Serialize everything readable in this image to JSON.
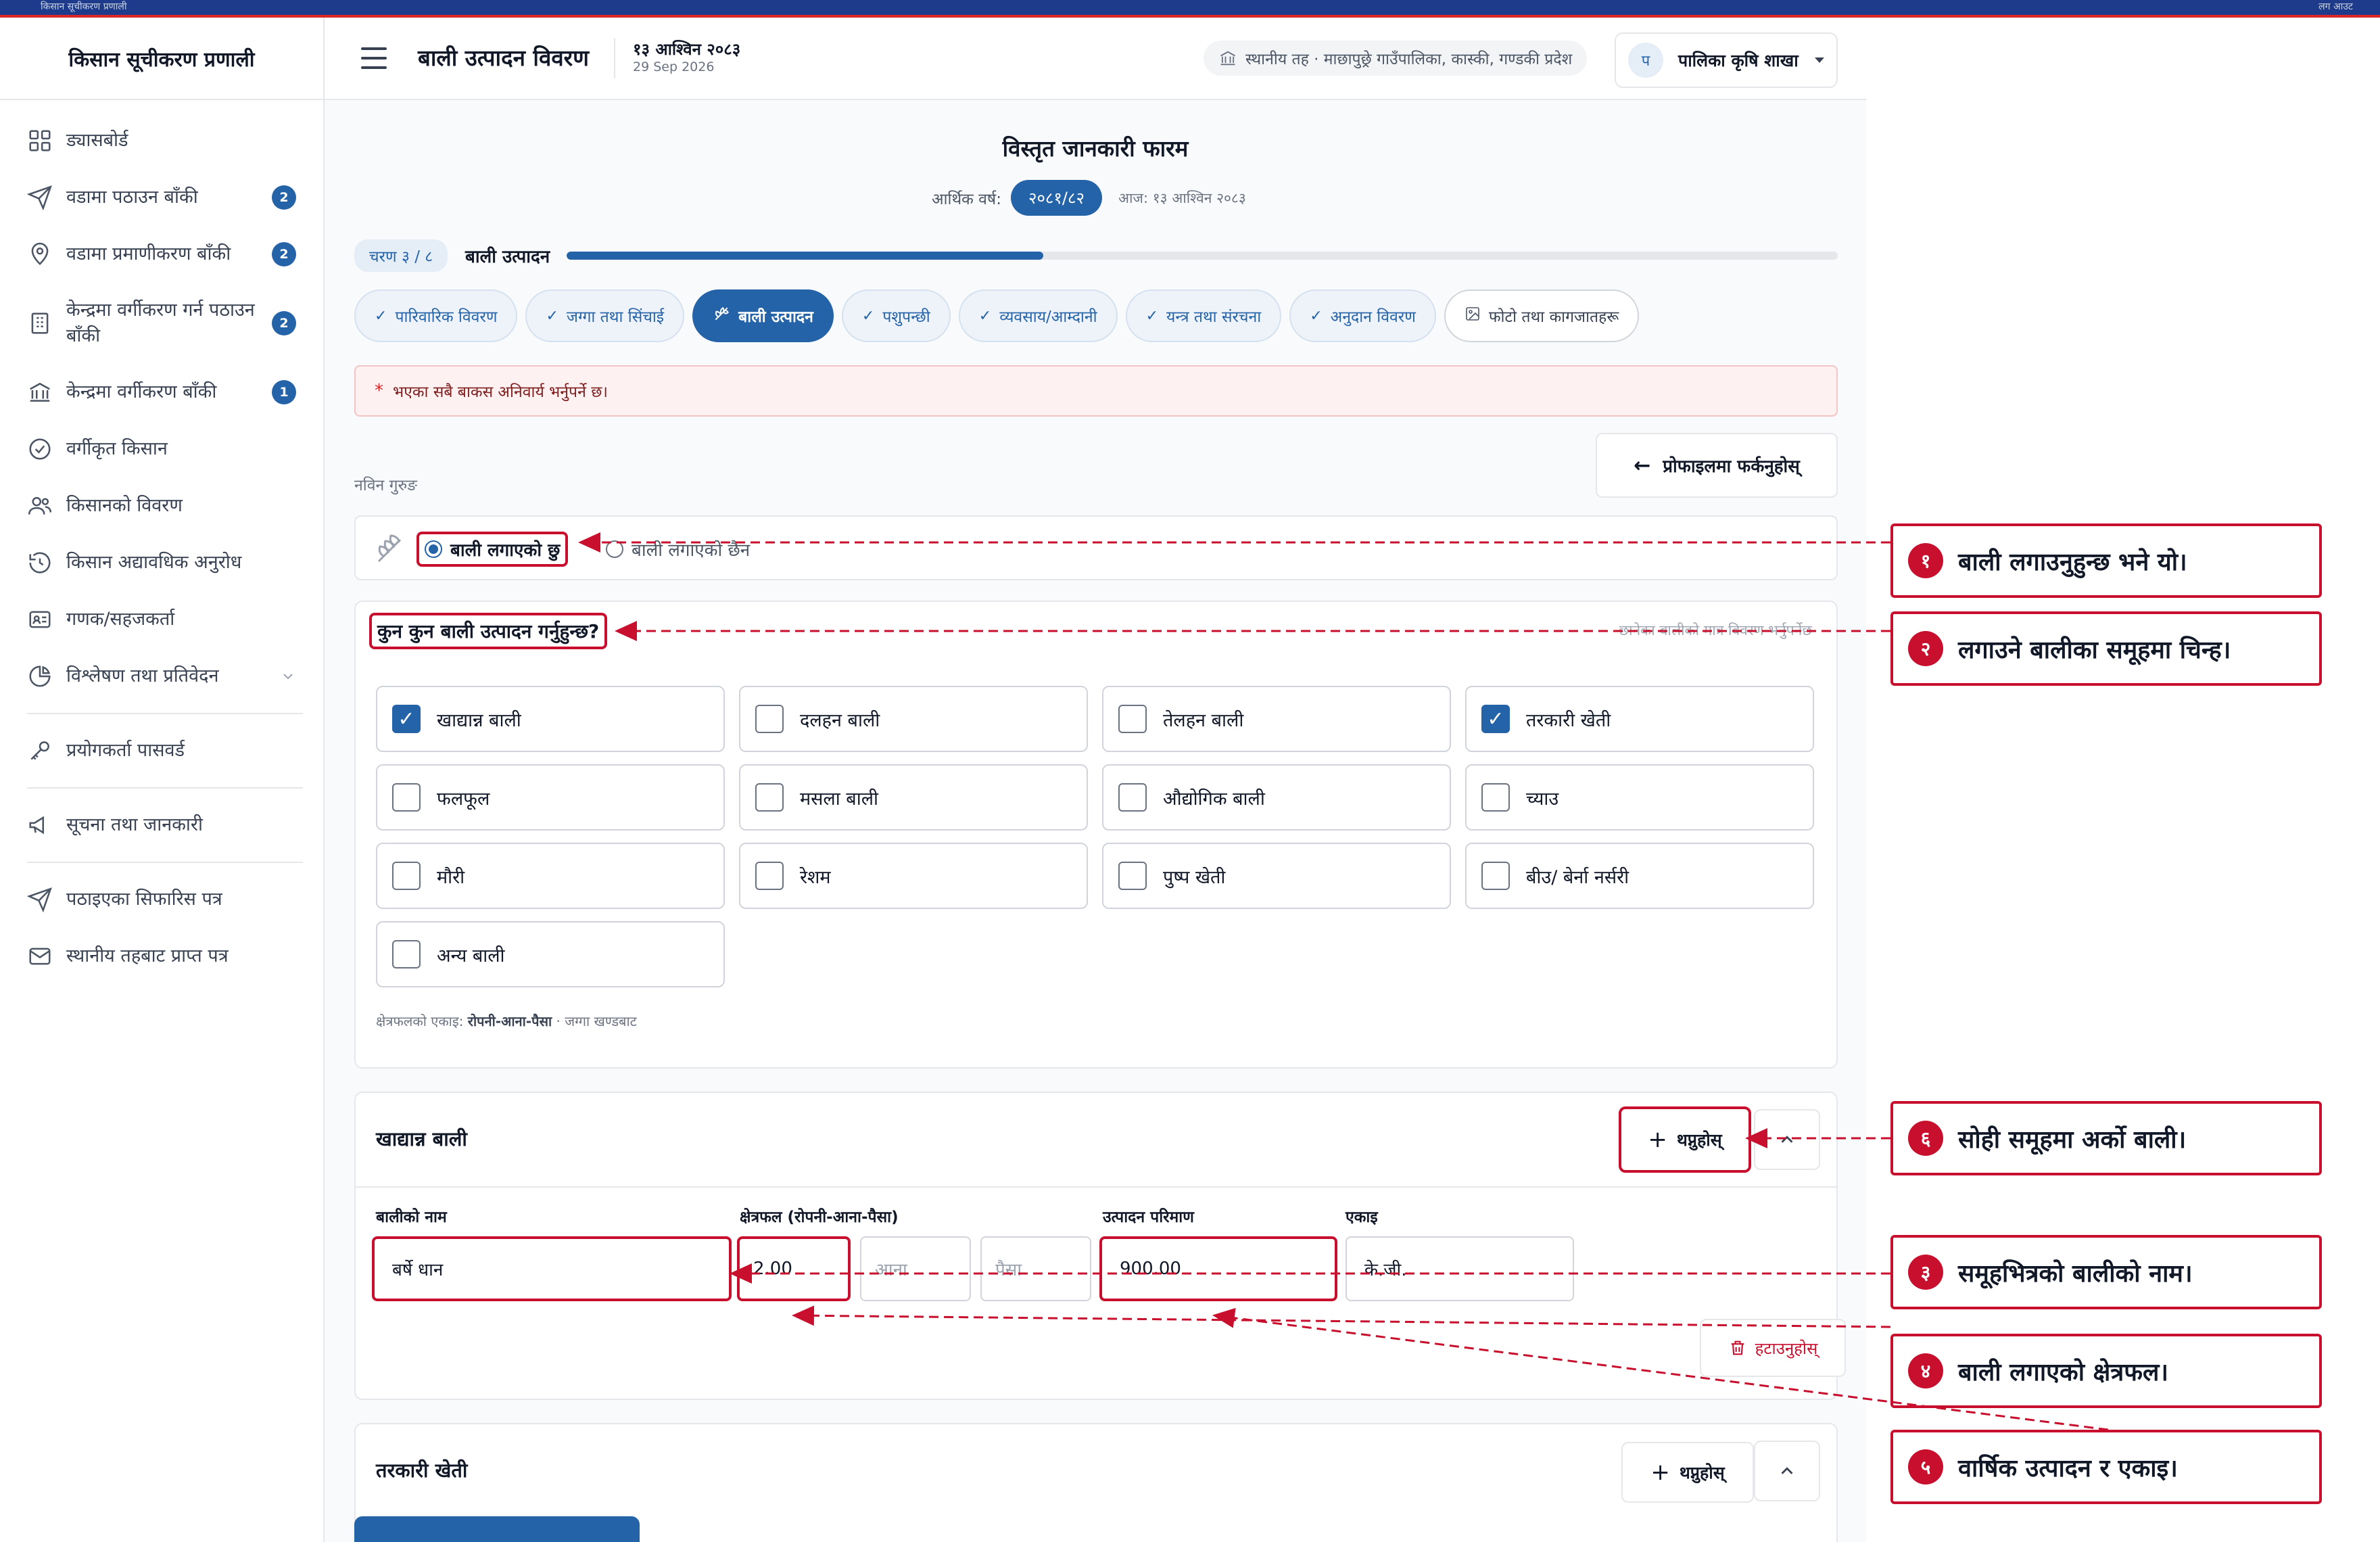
{
  "app": {
    "title": "किसान सूचीकरण प्रणाली",
    "topbar_left": "किसान सूचीकरण प्रणाली",
    "topbar_right": "लग आउट",
    "accent_color": "#2563a8",
    "annotation_color": "#c8102e"
  },
  "sidebar": {
    "items": [
      {
        "label": "ड्यासबोर्ड",
        "icon": "dashboard-icon",
        "badge": ""
      },
      {
        "label": "वडामा पठाउन बाँकी",
        "icon": "send-icon",
        "badge": "2"
      },
      {
        "label": "वडामा प्रमाणीकरण बाँकी",
        "icon": "location-pin-icon",
        "badge": "2"
      },
      {
        "label": "केन्द्रमा वर्गीकरण गर्न पठाउन बाँकी",
        "icon": "building-icon",
        "badge": "2"
      },
      {
        "label": "केन्द्रमा वर्गीकरण बाँकी",
        "icon": "bank-icon",
        "badge": "1"
      },
      {
        "label": "वर्गीकृत किसान",
        "icon": "check-circle-icon",
        "badge": ""
      },
      {
        "label": "किसानको विवरण",
        "icon": "users-icon",
        "badge": ""
      },
      {
        "label": "किसान अद्यावधिक अनुरोध",
        "icon": "history-icon",
        "badge": ""
      },
      {
        "label": "गणक/सहजकर्ता",
        "icon": "id-card-icon",
        "badge": ""
      },
      {
        "label": "विश्लेषण तथा प्रतिवेदन",
        "icon": "pie-chart-icon",
        "badge": ""
      },
      {
        "label": "प्रयोगकर्ता पासवर्ड",
        "icon": "key-icon",
        "badge": ""
      },
      {
        "label": "सूचना तथा जानकारी",
        "icon": "megaphone-icon",
        "badge": ""
      },
      {
        "label": "पठाइएका सिफारिस पत्र",
        "icon": "send-icon",
        "badge": ""
      },
      {
        "label": "स्थानीय तहबाट प्राप्त पत्र",
        "icon": "mail-icon",
        "badge": ""
      }
    ]
  },
  "header": {
    "page_title": "बाली उत्पादन विवरण",
    "date_np": "१३ आश्विन २०८३",
    "date_en": "29 Sep 2026",
    "location": "स्थानीय तह · माछापुछ्रे गाउँपालिका, कास्की, गण्डकी प्रदेश",
    "user_initial": "प",
    "user_name": "पालिका कृषि शाखा"
  },
  "form": {
    "title": "विस्तृत जानकारी फारम",
    "fiscal_year_label": "आर्थिक वर्ष:",
    "fiscal_year": "२०८१/८२",
    "today": "आज: १३ आश्विन २०८३",
    "step_badge": "चरण ३ / ८",
    "step_label": "बाली उत्पादन",
    "progress": 0.375,
    "tabs": [
      {
        "label": "पारिवारिक विवरण",
        "state": "done"
      },
      {
        "label": "जग्गा तथा सिंचाई",
        "state": "done"
      },
      {
        "label": "बाली उत्पादन",
        "state": "active"
      },
      {
        "label": "पशुपन्छी",
        "state": "done"
      },
      {
        "label": "व्यवसाय/आम्दानी",
        "state": "done"
      },
      {
        "label": "यन्त्र तथा संरचना",
        "state": "done"
      },
      {
        "label": "अनुदान विवरण",
        "state": "done"
      },
      {
        "label": "फोटो तथा कागजातहरू",
        "state": "pending"
      }
    ],
    "required_note": "भएका सबै बाकस अनिवार्य भर्नुपर्ने छ।",
    "back_button": "प्रोफाइलमा फर्कनुहोस्",
    "farmer_name": "नविन गुरुङ",
    "cultivated_yes": "बाली लगाएको छु",
    "cultivated_no": "बाली लगाएको छैन",
    "cultivated_selected": "yes",
    "crop_question": "कुन कुन बाली उत्पादन गर्नुहुन्छ?",
    "crop_hint": "छानेका बालीको मात्र विवरण भर्नुपर्नेछ",
    "crop_options": [
      {
        "label": "खाद्यान्न बाली",
        "checked": true
      },
      {
        "label": "दलहन बाली",
        "checked": false
      },
      {
        "label": "तेलहन बाली",
        "checked": false
      },
      {
        "label": "तरकारी खेती",
        "checked": true
      },
      {
        "label": "फलफूल",
        "checked": false
      },
      {
        "label": "मसला बाली",
        "checked": false
      },
      {
        "label": "औद्योगिक बाली",
        "checked": false
      },
      {
        "label": "च्याउ",
        "checked": false
      },
      {
        "label": "मौरी",
        "checked": false
      },
      {
        "label": "रेशम",
        "checked": false
      },
      {
        "label": "पुष्प खेती",
        "checked": false
      },
      {
        "label": "बीउ/ बेर्ना नर्सरी",
        "checked": false
      },
      {
        "label": "अन्य बाली",
        "checked": false
      }
    ],
    "unit_note_prefix": "क्षेत्रफलको एकाइ:",
    "unit_note_bold": "रोपनी-आना-पैसा",
    "unit_note_suffix": " · जग्गा खण्डबाट",
    "grain_group": {
      "title": "खाद्यान्न बाली",
      "add_label": "थप्नुहोस्",
      "col_name": "बालीको नाम",
      "col_area": "क्षेत्रफल (रोपनी-आना-पैसा)",
      "col_qty": "उत्पादन परिमाण",
      "col_unit": "एकाइ",
      "crop_name": "बर्षे धान",
      "area_ropani": "2.00",
      "area_aana_placeholder": "आना",
      "area_paisa_placeholder": "पैसा",
      "quantity": "900.00",
      "unit": "के.जी.",
      "remove_label": "हटाउनुहोस्"
    },
    "veg_group": {
      "title": "तरकारी खेती",
      "add_label": "थप्नुहोस्"
    }
  },
  "annotations": [
    {
      "num": "१",
      "text": "बाली लगाउनुहुन्छ भने यो।"
    },
    {
      "num": "२",
      "text": "लगाउने बालीका समूहमा चिन्ह।"
    },
    {
      "num": "६",
      "text": "सोही समूहमा अर्को बाली।"
    },
    {
      "num": "३",
      "text": "समूहभित्रको बालीको नाम।"
    },
    {
      "num": "४",
      "text": "बाली लगाएको क्षेत्रफल।"
    },
    {
      "num": "५",
      "text": "वार्षिक उत्पादन र एकाइ।"
    }
  ]
}
